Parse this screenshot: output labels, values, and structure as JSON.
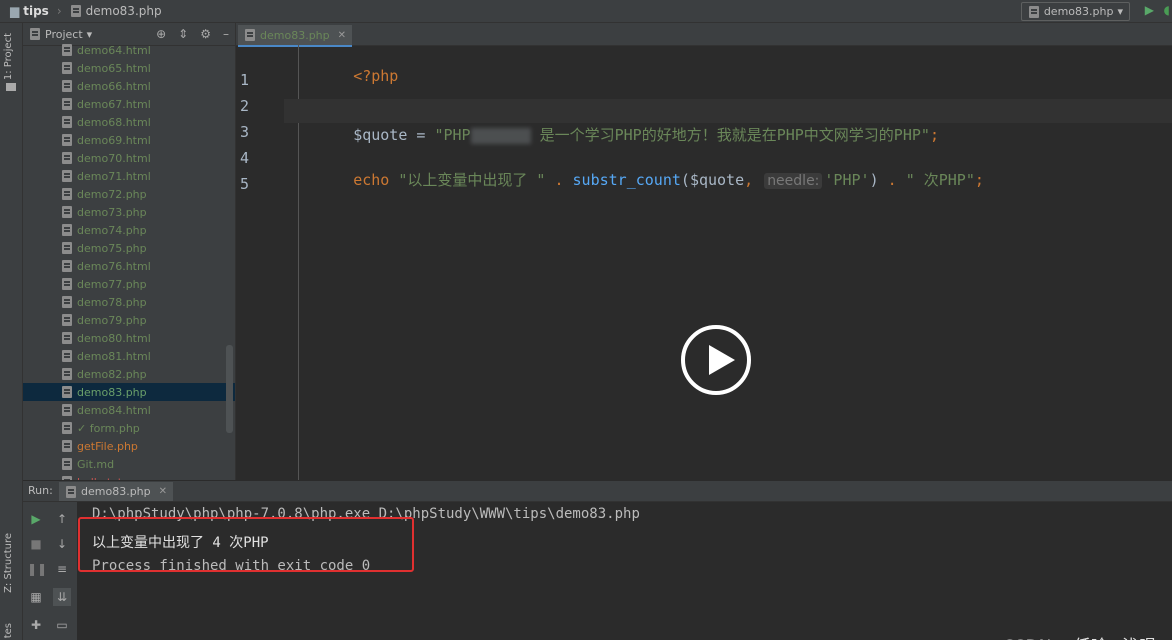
{
  "topbar": {
    "project": "tips",
    "file": "demo83.php",
    "run_config": "demo83.php"
  },
  "leftstrip": {
    "project_tab": "1: Project",
    "structure_tab": "Z: Structure",
    "favorites_tab": "tes"
  },
  "project_panel": {
    "title": "Project",
    "files": [
      "demo64.html",
      "demo65.html",
      "demo66.html",
      "demo67.html",
      "demo68.html",
      "demo69.html",
      "demo70.html",
      "demo71.html",
      "demo72.php",
      "demo73.php",
      "demo74.php",
      "demo75.php",
      "demo76.html",
      "demo77.php",
      "demo78.php",
      "demo79.php",
      "demo80.html",
      "demo81.html",
      "demo82.php",
      "demo83.php",
      "demo84.html",
      "✓ form.php",
      "getFile.php",
      "Git.md",
      "hello.txt"
    ],
    "selected": "demo83.php"
  },
  "editor": {
    "tab": "demo83.php",
    "line_numbers": [
      "1",
      "2",
      "3",
      "4",
      "5"
    ],
    "line1": "<?php",
    "line3_var": "$quote",
    "line3_eq": " = ",
    "line3_str_a": "\"PHP",
    "line3_str_b": " 是一个学习PHP的好地方！我就是在PHP中文网学习的PHP\"",
    "line3_end": ";",
    "line5_echo": "echo",
    "line5_str1": " \"以上变量中出现了 \"",
    "line5_dot1": " . ",
    "line5_fn": "substr_count",
    "line5_paren": "(",
    "line5_var": "$quote",
    "line5_comma": ", ",
    "line5_hint": "needle:",
    "line5_str2": "'PHP'",
    "line5_close": ")",
    "line5_dot2": " . ",
    "line5_str3": "\" 次PHP\"",
    "line5_end": ";"
  },
  "run": {
    "label": "Run:",
    "tab": "demo83.php",
    "console": [
      "D:\\phpStudy\\php\\php-7.0.8\\php.exe D:\\phpStudy\\WWW\\tips\\demo83.php",
      "以上变量中出现了 4 次PHP",
      "Process finished with exit code 0"
    ]
  },
  "watermark": "CSDN @低吟~浅唱",
  "colors": {
    "keyword": "#cc7832",
    "string": "#6a8759",
    "function": "#56a8f5",
    "highlight_box": "#e03030",
    "selection": "#0d293e"
  }
}
